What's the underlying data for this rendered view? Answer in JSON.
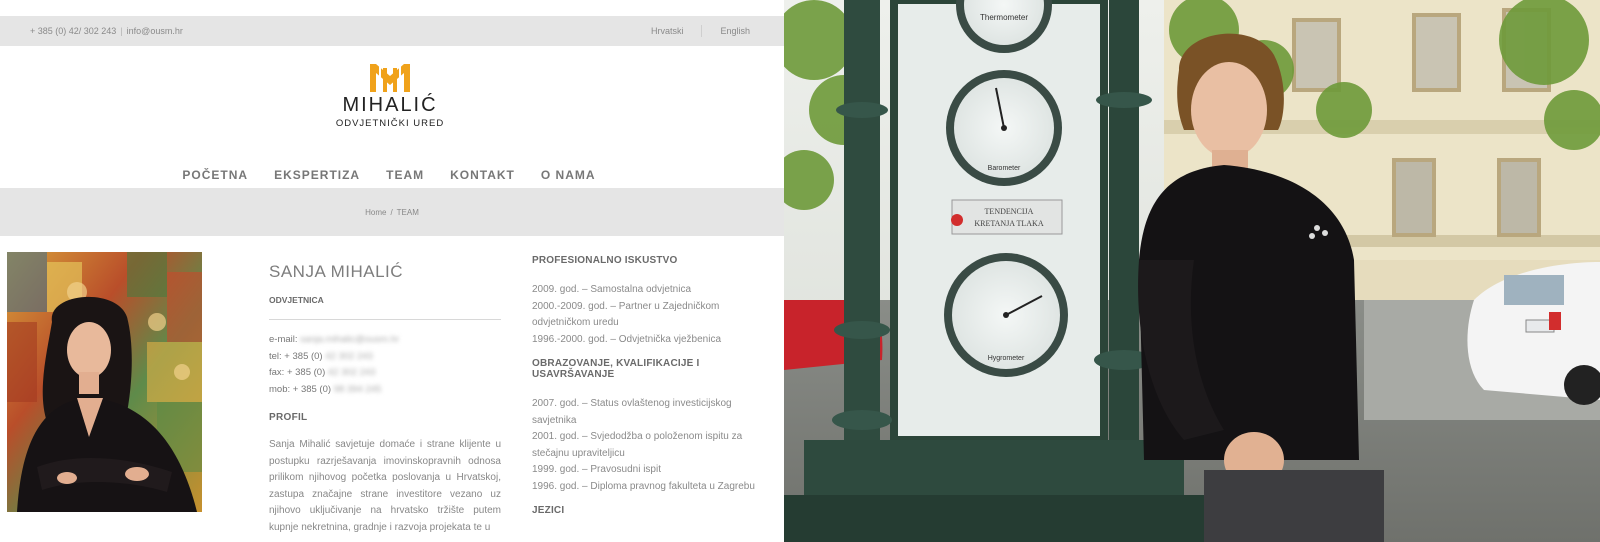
{
  "website": {
    "topbar": {
      "phone": "+ 385 (0) 42/ 302 243",
      "email": "info@ousm.hr",
      "languages": [
        "Hrvatski",
        "English"
      ]
    },
    "logo": {
      "brand": "MIHALIĆ",
      "tagline": "ODVJETNIČKI URED",
      "accent_color": "#f0a21a"
    },
    "nav": [
      "POČETNA",
      "EKSPERTIZA",
      "TEAM",
      "KONTAKT",
      "O NAMA"
    ],
    "breadcrumb": {
      "home": "Home",
      "separator": "/",
      "current": "TEAM"
    },
    "person": {
      "name": "SANJA MIHALIĆ",
      "role": "ODVJETNICA",
      "email_label": "e-mail:",
      "email_value": "sanja.mihalic@ousm.hr",
      "tel_label": "tel: + 385 (0)",
      "tel_value": "42 302 243",
      "fax_label": "fax: + 385 (0)",
      "fax_value": "42 302 243",
      "mob_label": "mob: + 385 (0)",
      "mob_value": "98 394 245"
    },
    "profil": {
      "heading": "PROFIL",
      "text": "Sanja Mihalić savjetuje domaće i strane klijente u postupku razrješavanja imovinskopravnih odnosa prilikom njihovog početka poslovanja u Hrvatskoj, zastupa značajne strane investitore vezano uz njihovo uključivanje na hrvatsko tržište putem kupnje nekretnina, gradnje i razvoja projekata te u"
    },
    "experience": {
      "heading": "PROFESIONALNO ISKUSTVO",
      "items": [
        "2009. god. – Samostalna odvjetnica",
        "2000.-2009. god. – Partner u Zajedničkom odvjetničkom uredu",
        "1996.-2000. god. – Odvjetnička vježbenica"
      ]
    },
    "education": {
      "heading": "OBRAZOVANJE, KVALIFIKACIJE I USAVRŠAVANJE",
      "items": [
        "2007. god. – Status ovlaštenog investicijskog savjetnika",
        "2001. god. – Svjedodžba o položenom ispitu za stečajnu upraviteljicu",
        "1999. god. – Pravosudni ispit",
        "1996. god. – Diploma pravnog fakulteta u Zagrebu"
      ]
    },
    "languages_section": {
      "heading": "JEZICI"
    }
  },
  "photo": {
    "gauges": {
      "thermometer": "Thermometer",
      "barometer": "Barometer",
      "hygrometer": "Hygrometer",
      "sign_line1": "TENDENCIJA",
      "sign_line2": "KRETANJA TLAKA"
    }
  }
}
